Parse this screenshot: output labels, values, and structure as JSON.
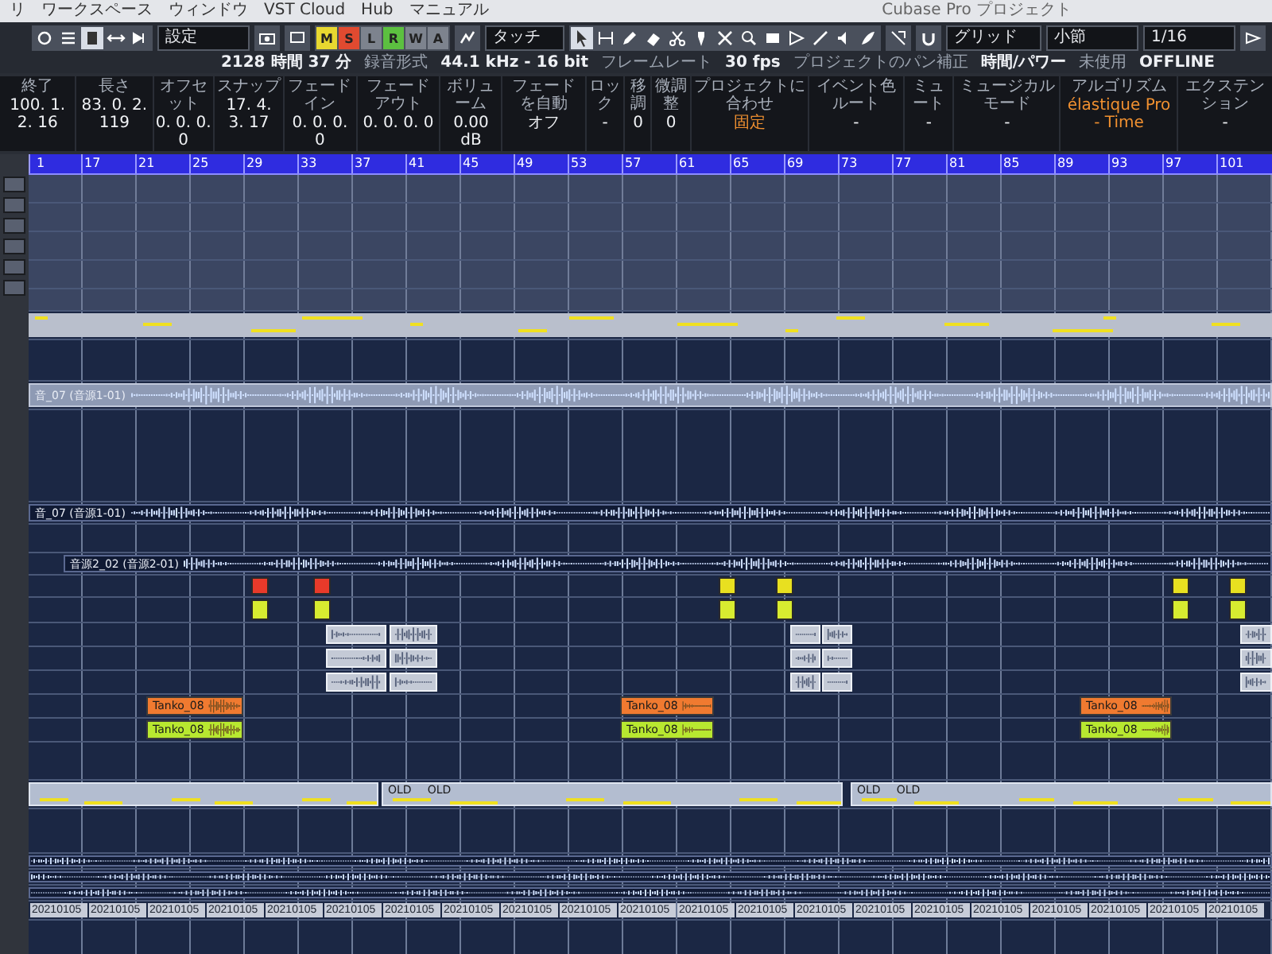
{
  "menu_bar": {
    "items": [
      "リ",
      "ワークスペース",
      "ウィンドウ",
      "VST Cloud",
      "Hub",
      "マニュアル"
    ]
  },
  "window": {
    "title": "Cubase Pro プロジェクト"
  },
  "toolbar": {
    "preset": "設定",
    "automation_buttons": [
      {
        "label": "M",
        "color": "#e8d830"
      },
      {
        "label": "S",
        "color": "#e04a30"
      },
      {
        "label": "L",
        "color": "#7d838e"
      },
      {
        "label": "R",
        "color": "#5cc040"
      },
      {
        "label": "W",
        "color": "#7d838e"
      },
      {
        "label": "A",
        "color": "#7d838e"
      }
    ],
    "automation_mode": "タッチ",
    "snap_type": "グリッド",
    "grid": "小節",
    "quantize": "1/16"
  },
  "status_line": [
    "2128 時間 37 分",
    "録音形式",
    "44.1 kHz - 16 bit",
    "フレームレート",
    "30 fps",
    "プロジェクトのパン補正",
    "時間/パワー",
    "未使用",
    "OFFLINE"
  ],
  "info_line": [
    {
      "label": "終了",
      "value": "100. 1. 2. 16",
      "highlight": false
    },
    {
      "label": "長さ",
      "value": "83. 0. 2. 119",
      "highlight": false
    },
    {
      "label": "オフセット",
      "value": "0. 0. 0. 0",
      "highlight": false
    },
    {
      "label": "スナップ",
      "value": "17. 4. 3. 17",
      "highlight": false
    },
    {
      "label": "フェードイン",
      "value": "0. 0. 0. 0",
      "highlight": false
    },
    {
      "label": "フェードアウト",
      "value": "0. 0. 0. 0",
      "highlight": false
    },
    {
      "label": "ボリューム",
      "value": "0.00 dB",
      "highlight": false
    },
    {
      "label": "フェードを自動",
      "value": "オフ",
      "highlight": false
    },
    {
      "label": "ロック",
      "value": "-",
      "highlight": false
    },
    {
      "label": "移調",
      "value": "0",
      "highlight": false
    },
    {
      "label": "微調整",
      "value": "0",
      "highlight": false
    },
    {
      "label": "プロジェクトに合わせ",
      "value": "固定",
      "highlight": true
    },
    {
      "label": "イベント色ルート",
      "value": "-",
      "highlight": false
    },
    {
      "label": "ミュート",
      "value": "-",
      "highlight": false
    },
    {
      "label": "ミュージカルモード",
      "value": "-",
      "highlight": false
    },
    {
      "label": "アルゴリズム",
      "value": "élastique Pro - Time",
      "highlight": true
    },
    {
      "label": "エクステンション",
      "value": "-",
      "highlight": false
    }
  ],
  "ruler": {
    "bars": [
      "1",
      "17",
      "21",
      "25",
      "29",
      "33",
      "37",
      "41",
      "45",
      "49",
      "53",
      "57",
      "61",
      "65",
      "69",
      "73",
      "77",
      "81",
      "85",
      "89",
      "93",
      "97",
      "101"
    ]
  },
  "events": [
    {
      "kind": "midi"
    },
    {
      "kind": "shaded",
      "name": "音_07 (音源1-01)"
    },
    {
      "kind": "audio",
      "name": "音_07 (音源1-01)"
    },
    {
      "kind": "audio",
      "name": "音源2_02 (音源2-01)"
    },
    {
      "kind": "clip",
      "color": "#e83a2a"
    },
    {
      "kind": "clip",
      "color": "#e83a2a"
    },
    {
      "kind": "clip",
      "color": "#e8e020"
    },
    {
      "kind": "clip",
      "color": "#e8e020"
    },
    {
      "kind": "clip",
      "color": "#e8e020"
    },
    {
      "kind": "clip",
      "color": "#e8e020"
    },
    {
      "kind": "clip",
      "color": "#d8ec30"
    },
    {
      "kind": "clip",
      "color": "#d8ec30"
    },
    {
      "kind": "clip",
      "color": "#d8ec30"
    },
    {
      "kind": "clip",
      "color": "#d8ec30"
    },
    {
      "kind": "clip",
      "color": "#d8ec30"
    },
    {
      "kind": "clip",
      "color": "#d8ec30"
    },
    {
      "kind": "take"
    },
    {
      "kind": "take"
    },
    {
      "kind": "take"
    },
    {
      "kind": "take"
    },
    {
      "kind": "take"
    },
    {
      "kind": "take"
    },
    {
      "kind": "take"
    },
    {
      "kind": "take"
    },
    {
      "kind": "take"
    },
    {
      "kind": "take"
    },
    {
      "kind": "take"
    },
    {
      "kind": "take"
    },
    {
      "kind": "take"
    },
    {
      "kind": "take"
    },
    {
      "kind": "take"
    },
    {
      "kind": "colored",
      "name": "Tanko_08",
      "color": "#f07a30"
    },
    {
      "kind": "colored",
      "name": "Tanko_08",
      "color": "#f07a30"
    },
    {
      "kind": "colored",
      "name": "Tanko_08",
      "color": "#f07a30"
    },
    {
      "kind": "colored",
      "name": "Tanko_08",
      "color": "#b8e830"
    },
    {
      "kind": "colored",
      "name": "Tanko_08",
      "color": "#b8e830"
    },
    {
      "kind": "colored",
      "name": "Tanko_08",
      "color": "#b8e830"
    },
    {
      "kind": "part"
    },
    {
      "kind": "part",
      "labels": [
        "OLD",
        "OLD"
      ]
    },
    {
      "kind": "part",
      "labels": [
        "OLD",
        "OLD"
      ]
    },
    {
      "kind": "audio"
    },
    {
      "kind": "audio"
    },
    {
      "kind": "audio"
    },
    {
      "kind": "file",
      "name": "20210105"
    },
    {
      "kind": "file",
      "name": "20210105"
    },
    {
      "kind": "file",
      "name": "20210105"
    },
    {
      "kind": "file",
      "name": "20210105"
    },
    {
      "kind": "file",
      "name": "20210105"
    },
    {
      "kind": "file",
      "name": "20210105"
    },
    {
      "kind": "file",
      "name": "20210105"
    },
    {
      "kind": "file",
      "name": "20210105"
    },
    {
      "kind": "file",
      "name": "20210105"
    },
    {
      "kind": "file",
      "name": "20210105"
    },
    {
      "kind": "file",
      "name": "20210105"
    },
    {
      "kind": "file",
      "name": "20210105"
    },
    {
      "kind": "file",
      "name": "20210105"
    },
    {
      "kind": "file",
      "name": "20210105"
    },
    {
      "kind": "file",
      "name": "20210105"
    },
    {
      "kind": "file",
      "name": "20210105"
    },
    {
      "kind": "file",
      "name": "20210105"
    },
    {
      "kind": "file",
      "name": "20210105"
    },
    {
      "kind": "file",
      "name": "20210105"
    },
    {
      "kind": "file",
      "name": "20210105"
    },
    {
      "kind": "file",
      "name": "20210105"
    }
  ]
}
